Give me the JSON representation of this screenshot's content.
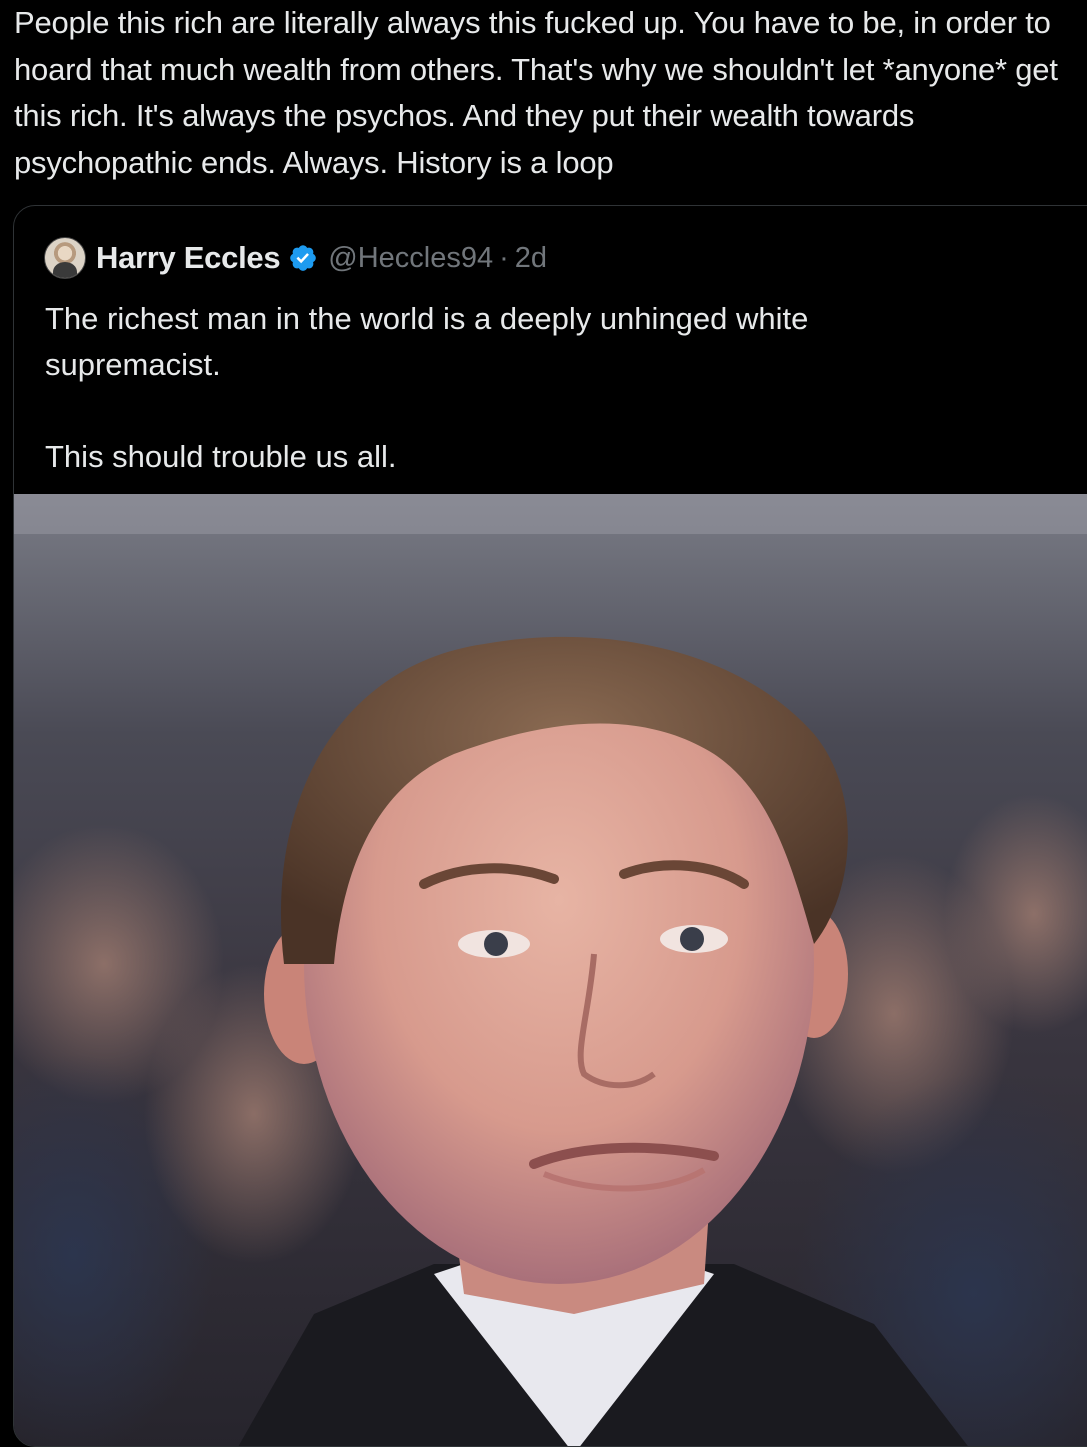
{
  "post": {
    "text": "People this rich are literally always this fucked up. You have to be, in order to hoard that much wealth from others. That's why we shouldn't let *anyone* get this rich. It's always the psychos. And they put their wealth towards psychopathic ends. Always. History is a loop"
  },
  "quoted_post": {
    "author_name": "Harry Eccles",
    "handle": "@Heccles94",
    "separator": "·",
    "time": "2d",
    "verified_icon": "verified-badge-icon",
    "text": "The richest man in the world is a deeply unhinged white\nsupremacist.\n\nThis should trouble us all.",
    "image": "photo of a man with brown hair in a dark suit and white shirt at an event"
  },
  "colors": {
    "background": "#000000",
    "text_primary": "#e7e9ea",
    "text_secondary": "#71767b",
    "verified_blue": "#1d9bf0",
    "border": "#2f3336"
  }
}
